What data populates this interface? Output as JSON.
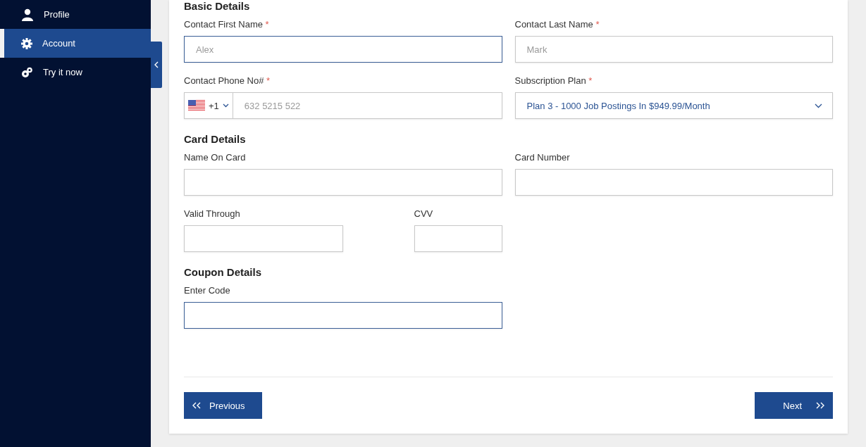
{
  "sidebar": {
    "items": [
      {
        "label": "Profile",
        "selected": false
      },
      {
        "label": "Account",
        "selected": true
      },
      {
        "label": "Try it now",
        "selected": false
      }
    ]
  },
  "form": {
    "sections": [
      {
        "heading": "Basic Details",
        "rows": [
          {
            "kind": "wide",
            "fields": [
              {
                "kind": "text",
                "label": "Contact First Name",
                "required_mark": "*",
                "placeholder": "Alex",
                "focused": true
              },
              {
                "kind": "text",
                "label": "Contact Last Name",
                "required_mark": "*",
                "placeholder": "Mark",
                "focused": false
              }
            ]
          },
          {
            "kind": "wide",
            "fields": [
              {
                "kind": "phone",
                "label": "Contact Phone No#",
                "required_mark": "*",
                "country_code": "+1",
                "placeholder": "632 5215 522",
                "focused": false
              },
              {
                "kind": "select",
                "label": "Subscription Plan",
                "required_mark": "*",
                "value": "Plan 3 - 1000 Job Postings In $949.99/Month",
                "focused": false
              }
            ]
          }
        ]
      },
      {
        "heading": "Card Details",
        "rows": [
          {
            "kind": "wide",
            "fields": [
              {
                "kind": "text",
                "label": "Name On Card",
                "focused": false
              },
              {
                "kind": "text",
                "label": "Card Number",
                "focused": false
              }
            ]
          },
          {
            "kind": "compact",
            "fields": [
              {
                "kind": "text",
                "label": "Valid Through",
                "focused": false
              },
              {
                "kind": "text",
                "label": "CVV",
                "focused": false
              }
            ]
          }
        ]
      },
      {
        "heading": "Coupon Details",
        "rows": [
          {
            "kind": "half",
            "fields": [
              {
                "kind": "text",
                "label": "Enter Code",
                "focused": true
              }
            ]
          }
        ]
      }
    ],
    "buttons": [
      {
        "label": "Previous",
        "kind": "back"
      },
      {
        "label": "Next",
        "kind": "forward"
      }
    ]
  }
}
